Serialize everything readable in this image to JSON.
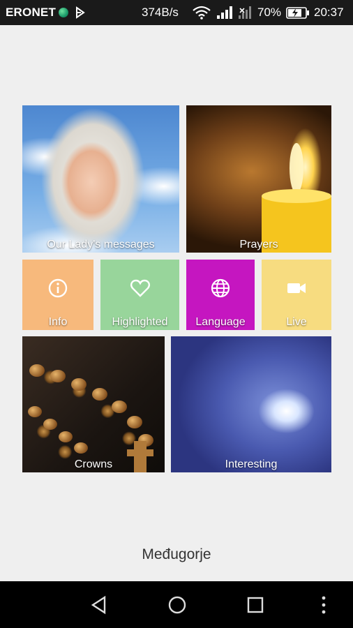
{
  "status_bar": {
    "carrier": "ERONET",
    "net_speed": "374B/s",
    "battery_percent": "70%",
    "time": "20:37",
    "icons": [
      "globe-icon",
      "play-store-icon",
      "wifi-icon",
      "signal-icon",
      "no-signal-icon",
      "battery-charging-icon"
    ]
  },
  "tiles": {
    "messages": {
      "label": "Our Lady's messages"
    },
    "prayers": {
      "label": "Prayers"
    },
    "info": {
      "label": "Info",
      "icon": "info-icon",
      "color": "#f7b97c"
    },
    "highlighted": {
      "label": "Highlighted",
      "icon": "heart-icon",
      "color": "#98d59b"
    },
    "language": {
      "label": "Language",
      "icon": "globe-icon",
      "color": "#c516c0"
    },
    "live": {
      "label": "Live",
      "icon": "video-camera-icon",
      "color": "#f7dc80"
    },
    "crowns": {
      "label": "Crowns"
    },
    "interesting": {
      "label": "Interesting"
    }
  },
  "app_name": "Međugorje",
  "nav_bar": {
    "icons": [
      "back-icon",
      "home-icon",
      "recents-icon",
      "menu-icon"
    ]
  }
}
